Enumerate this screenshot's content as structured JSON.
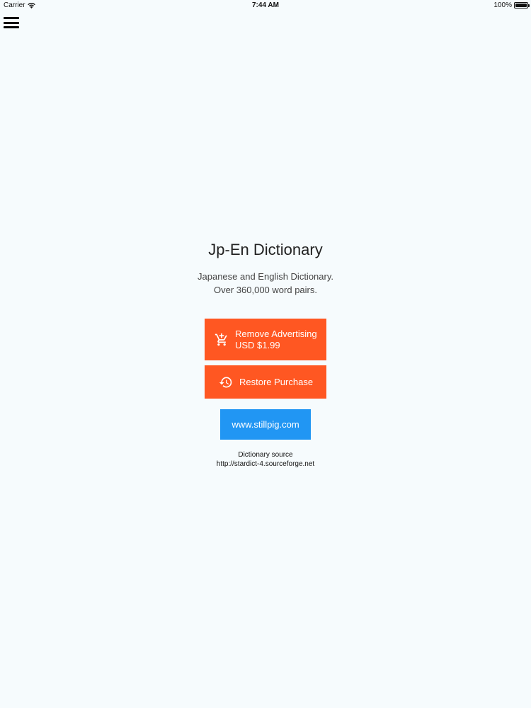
{
  "status_bar": {
    "carrier": "Carrier",
    "time": "7:44 AM",
    "battery_text": "100%",
    "battery_level": 1.0
  },
  "main": {
    "title": "Jp-En Dictionary",
    "tagline_line1": "Japanese and English Dictionary.",
    "tagline_line2": "Over 360,000 word pairs.",
    "remove_ads_line1": "Remove Advertising",
    "remove_ads_line2": "USD $1.99",
    "restore_label": "Restore Purchase",
    "website_label": "www.stillpig.com",
    "source_label": "Dictionary source",
    "source_url": "http://stardict-4.sourceforge.net"
  },
  "colors": {
    "background": "#f6fbfd",
    "orange_button": "#ff5722",
    "blue_button": "#2196f3"
  },
  "icons": {
    "menu": "hamburger-menu-icon",
    "remove_ads": "add-shopping-cart-icon",
    "restore": "restore-history-icon",
    "wifi": "wifi-icon"
  }
}
